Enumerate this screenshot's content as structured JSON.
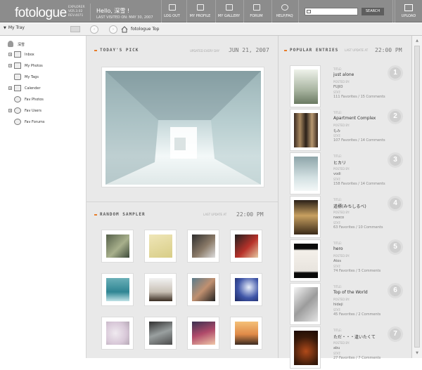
{
  "app": {
    "logo_text": "fotologue",
    "logo_sub": [
      "EXPLORER",
      "VER.3.02",
      "REV.4071"
    ]
  },
  "greeting": {
    "hello": "Hello, 深雪 !",
    "last_visited": "LAST VISITED ON: MAY 30, 2007"
  },
  "nav": [
    {
      "label": "LOG OUT",
      "icon": "logout-icon"
    },
    {
      "label": "MY PROFILE",
      "icon": "profile-icon"
    },
    {
      "label": "MY GALLERY",
      "icon": "gallery-icon"
    },
    {
      "label": "FORUM",
      "icon": "forum-icon"
    },
    {
      "label": "HELP/FAQ",
      "icon": "help-icon"
    }
  ],
  "search": {
    "button": "SEARCH",
    "value": ""
  },
  "upload": {
    "label": "UPLOAD"
  },
  "subbar": {
    "tray": "My Tray",
    "breadcrumb": "fotologue Top"
  },
  "sidebar": {
    "user": "深雪",
    "items": [
      {
        "label": "Inbox",
        "expand": "+"
      },
      {
        "label": "My Photos",
        "expand": "+"
      },
      {
        "label": "My Tags",
        "expand": ""
      },
      {
        "label": "Calender",
        "expand": "+"
      },
      {
        "label": "Fav Photos",
        "expand": ""
      },
      {
        "label": "Fav Users",
        "expand": "+"
      },
      {
        "label": "Fav Forums",
        "expand": ""
      }
    ]
  },
  "todays_pick": {
    "title": "TODAY'S PICK",
    "updated_label": "UPDATED EVERY DAY",
    "date": "JUN 21, 2007"
  },
  "random_sampler": {
    "title": "RANDOM SAMPLER",
    "update_label": "LAST UPDATE AT",
    "time": "22:00 PM"
  },
  "popular": {
    "title": "POPULAR ENTRIES",
    "update_label": "LAST UPDATE AT",
    "time": "22:00 PM",
    "labels": {
      "title": "TITLE:",
      "posted": "POSTED BY:",
      "stat": "STAT:"
    },
    "entries": [
      {
        "rank": "1",
        "title": "just alone",
        "posted_by": "FUJIO",
        "stat": "111 Favorites / 15 Comments"
      },
      {
        "rank": "2",
        "title": "Apartment Complex",
        "posted_by": "もみ",
        "stat": "107 Favorites / 14 Comments"
      },
      {
        "rank": "3",
        "title": "ヒカリ",
        "posted_by": "vodi",
        "stat": "158 Favorites / 14 Comments"
      },
      {
        "rank": "4",
        "title": "道標(みちしるべ)",
        "posted_by": "naoco",
        "stat": "63 Favorites / 10 Comments"
      },
      {
        "rank": "5",
        "title": "hero",
        "posted_by": "Atos",
        "stat": "74 Favorites / 5 Comments"
      },
      {
        "rank": "6",
        "title": "Top of the World",
        "posted_by": "hideji",
        "stat": "45 Favorites / 2 Comments"
      },
      {
        "rank": "7",
        "title": "ただ・・・逢いたくて",
        "posted_by": "abu",
        "stat": "27 Favorites / 7 Comments"
      }
    ]
  },
  "colors": {
    "header": "#8c8c8c",
    "accent": "#e87d2a",
    "panel": "#e9e9e9"
  }
}
